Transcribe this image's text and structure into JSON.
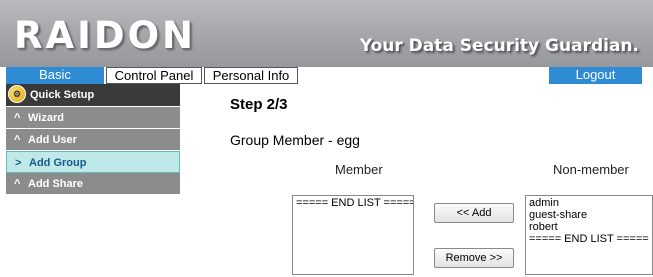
{
  "header": {
    "logo": "RAIDON",
    "tagline": "Your Data Security Guardian."
  },
  "tabs": {
    "basic": "Basic",
    "control_panel": "Control Panel",
    "personal_info": "Personal Info",
    "logout": "Logout"
  },
  "sidebar": {
    "quick_setup": "Quick Setup",
    "items": [
      {
        "arrow": "^",
        "label": "Wizard"
      },
      {
        "arrow": "^",
        "label": "Add User"
      },
      {
        "arrow": ">",
        "label": "Add Group"
      },
      {
        "arrow": "^",
        "label": "Add Share"
      }
    ]
  },
  "main": {
    "step": "Step 2/3",
    "group_title": "Group Member - egg",
    "member_label": "Member",
    "nonmember_label": "Non-member",
    "member_list": [
      "===== END LIST ====="
    ],
    "nonmember_list": [
      "admin",
      "guest-share",
      "robert",
      "===== END LIST ====="
    ],
    "add_button": "<< Add",
    "remove_button": "Remove >>"
  },
  "colors": {
    "tab_active": "#2e8bd4",
    "sidebar_head": "#3a3a3a",
    "sidebar_item": "#8c8c8c",
    "sidebar_active": "#bfe9e8"
  }
}
